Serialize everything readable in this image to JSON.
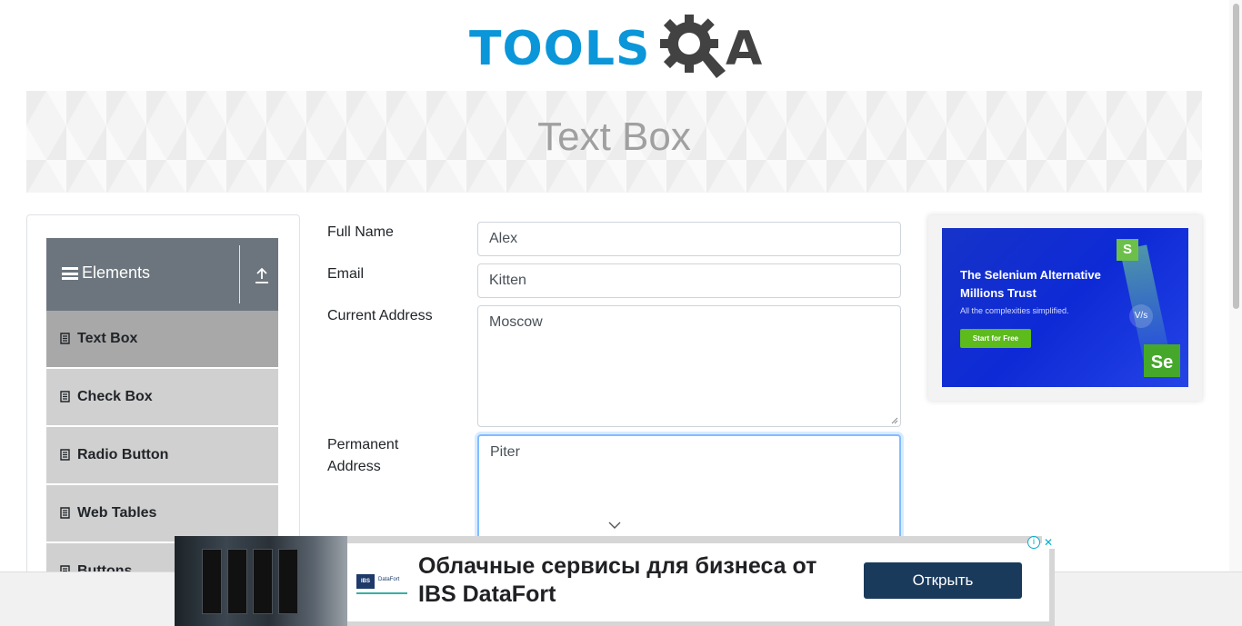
{
  "logo": {
    "text_main": "TOOLS",
    "text_end": "A",
    "alt": "TOOLSQA"
  },
  "banner": {
    "title": "Text Box"
  },
  "sidebar": {
    "group_title": "Elements",
    "items": [
      {
        "label": "Text Box",
        "active": true
      },
      {
        "label": "Check Box",
        "active": false
      },
      {
        "label": "Radio Button",
        "active": false
      },
      {
        "label": "Web Tables",
        "active": false
      },
      {
        "label": "Buttons",
        "active": false
      }
    ]
  },
  "form": {
    "full_name": {
      "label": "Full Name",
      "value": "Alex"
    },
    "email": {
      "label": "Email",
      "value": "Kitten"
    },
    "current_address": {
      "label": "Current Address",
      "value": "Moscow"
    },
    "permanent_address": {
      "label_line1": "Permanent",
      "label_line2": "Address",
      "value": "Piter"
    }
  },
  "side_ad": {
    "title": "The Selenium Alternative Millions Trust",
    "subtitle": "All the complexities simplified.",
    "button": "Start for Free",
    "badge_s": "S",
    "badge_vs": "V/s",
    "badge_se": "Se"
  },
  "bottom_ad": {
    "brand": "IBS",
    "brand_name": "DataFort",
    "headline": "Облачные сервисы для бизнеса от IBS DataFort",
    "button": "Открыть",
    "adchoices": "i",
    "close": "✕"
  },
  "colors": {
    "brand_blue": "#0a96d8",
    "brand_dark": "#424242",
    "group_header": "#6c757d",
    "menu_item": "#d0d0d0",
    "menu_item_active": "#a8a8a8",
    "focus": "#80bdff"
  }
}
